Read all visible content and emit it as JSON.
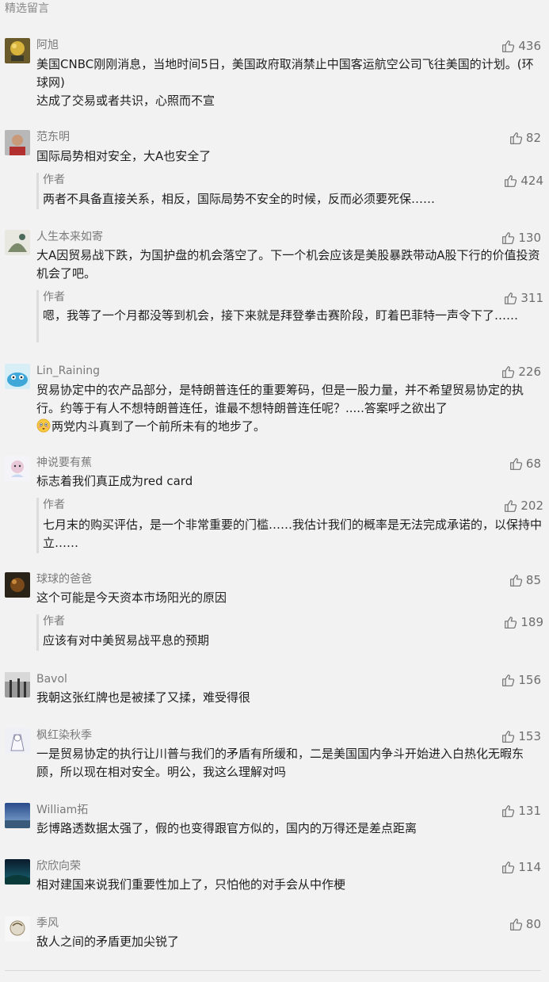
{
  "section": {
    "title": "精选留言"
  },
  "comments": [
    {
      "nickname": "阿旭",
      "likes": "436",
      "text1": "美国CNBC刚刚消息，当地时间5日，美国政府取消禁止中国客运航空公司飞往美国的计划。(环球网)",
      "text2": "达成了交易或者共识，心照而不宣"
    },
    {
      "nickname": "范东明",
      "likes": "82",
      "text": "国际局势相对安全，大A也安全了",
      "reply": {
        "author": "作者",
        "likes": "424",
        "text": "两者不具备直接关系，相反，国际局势不安全的时候，反而必须要死保……"
      }
    },
    {
      "nickname": "人生本来如寄",
      "likes": "130",
      "text": "大A因贸易战下跌，为国护盘的机会落空了。下一个机会应该是美股暴跌带动A股下行的价值投资机会了吧。",
      "reply": {
        "author": "作者",
        "likes": "311",
        "text": "嗯，我等了一个月都没等到机会，接下来就是拜登拳击赛阶段，盯着巴菲特一声令下了……"
      }
    },
    {
      "nickname": "Lin_Raining",
      "likes": "226",
      "text1": "贸易协定中的农产品部分，是特朗普连任的重要筹码，但是一股力量，并不希望贸易协定的执行。约等于有人不想特朗普连任，谁最不想特朗普连任呢？.....答案呼之欲出了",
      "text2": "两党内斗真到了一个前所未有的地步了。"
    },
    {
      "nickname": "神说要有蕉",
      "likes": "68",
      "text": "标志着我们真正成为red card",
      "reply": {
        "author": "作者",
        "likes": "202",
        "text": "七月末的购买评估，是一个非常重要的门槛……我估计我们的概率是无法完成承诺的，以保持中立……"
      }
    },
    {
      "nickname": "球球的爸爸",
      "likes": "85",
      "text": "这个可能是今天资本市场阳光的原因",
      "reply": {
        "author": "作者",
        "likes": "189",
        "text": "应该有对中美贸易战平息的预期"
      }
    },
    {
      "nickname": "Bavol",
      "likes": "156",
      "text": "我朝这张红牌也是被揉了又揉，难受得很"
    },
    {
      "nickname": "枫红染秋季",
      "likes": "153",
      "text": "一是贸易协定的执行让川普与我们的矛盾有所缓和，二是美国国内争斗开始进入白热化无暇东顾，所以现在相对安全。明公，我这么理解对吗"
    },
    {
      "nickname": "William拓",
      "likes": "131",
      "text": "彭博路透数据太强了，假的也变得跟官方似的，国内的万得还是差点距离"
    },
    {
      "nickname": "欣欣向荣",
      "likes": "114",
      "text": "相对建国来说我们重要性加上了，只怕他的对手会从中作梗"
    },
    {
      "nickname": "季风",
      "likes": "80",
      "text": "敌人之间的矛盾更加尖锐了"
    }
  ],
  "icons": {
    "like": "thumbs-up-icon",
    "emoji": "flushed-face-emoji"
  },
  "colors": {
    "background": "#f2f2f2",
    "nickname": "#7a7a7a",
    "body_text": "#1e1e1e",
    "reply_bar": "#dcdcdc"
  }
}
